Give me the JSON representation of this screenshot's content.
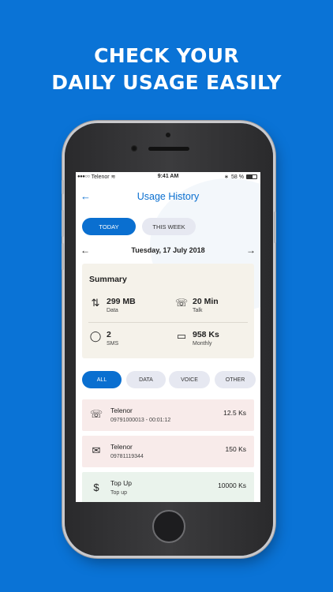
{
  "headline": {
    "line1": "CHECK YOUR",
    "line2": "DAILY USAGE EASILY"
  },
  "status_bar": {
    "carrier": "Telenor",
    "time": "9:41 AM",
    "battery": "58 %",
    "signal": "●●●○○",
    "wifi": "≋",
    "bluetooth": "∗"
  },
  "nav": {
    "back_icon": "←",
    "title": "Usage History"
  },
  "period_tabs": {
    "today": "TODAY",
    "this_week": "THIS WEEK"
  },
  "date_nav": {
    "prev_icon": "←",
    "date": "Tuesday, 17 July 2018",
    "next_icon": "→"
  },
  "summary": {
    "title": "Summary",
    "data": {
      "icon": "⇅",
      "value": "299 MB",
      "label": "Data"
    },
    "talk": {
      "icon": "☏",
      "value": "20 Min",
      "label": "Talk"
    },
    "sms": {
      "icon": "◯",
      "value": "2",
      "label": "SMS"
    },
    "monthly": {
      "icon": "▭",
      "value": "958 Ks",
      "label": "Monthly"
    }
  },
  "filters": {
    "all": "ALL",
    "data": "DATA",
    "voice": "VOICE",
    "other": "OTHER"
  },
  "transactions": [
    {
      "icon": "☏",
      "name": "Telenor",
      "detail": "09791000013 - 00:01:12",
      "amount": "12.5 Ks"
    },
    {
      "icon": "✉",
      "name": "Telenor",
      "detail": "09781119344",
      "amount": "150 Ks"
    },
    {
      "icon": "$",
      "name": "Top Up",
      "detail": "Top up",
      "amount": "10000 Ks"
    }
  ],
  "colors": {
    "background": "#0a73d6",
    "accent": "#0a6fd0",
    "summary_bg": "#f5f2ea",
    "call_row_bg": "#f8ebea",
    "topup_row_bg": "#eaf3ec"
  }
}
